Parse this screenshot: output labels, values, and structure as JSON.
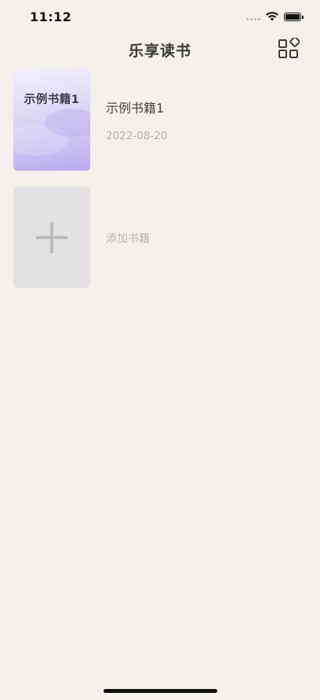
{
  "status_bar": {
    "time": "11:12"
  },
  "nav": {
    "title": "乐享读书",
    "grid_icon": "grid-apps-icon"
  },
  "books": [
    {
      "cover_title": "示例书籍1",
      "title": "示例书籍1",
      "date": "2022-08-20"
    }
  ],
  "add_book": {
    "label": "添加书籍",
    "icon": "plus-icon"
  },
  "colors": {
    "background": "#f4f0eb",
    "cover_gradient_start": "#f2f0fb",
    "cover_gradient_end": "#b8abef",
    "add_tile": "#e3e1e4"
  }
}
